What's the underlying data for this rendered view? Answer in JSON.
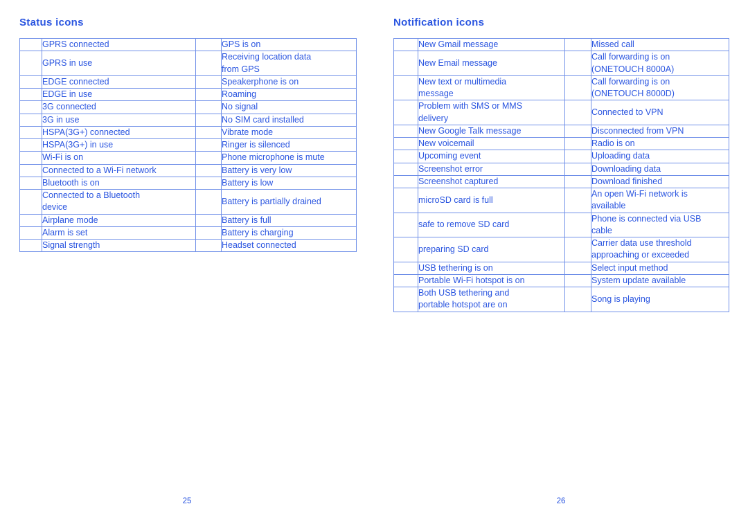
{
  "document": {
    "accent_color": "#2a55e0",
    "border_color": "#6f8fe8",
    "background_color": "#ffffff"
  },
  "left_page": {
    "heading": "Status icons",
    "page_number": "25",
    "rows": [
      {
        "icon_left": "status-icon",
        "label_left": "GPRS connected",
        "icon_right": "status-icon",
        "label_right": "GPS is on"
      },
      {
        "icon_left": "status-icon",
        "label_left": "GPRS in use",
        "icon_right": "status-icon",
        "label_right": "Receiving location data\nfrom GPS"
      },
      {
        "icon_left": "status-icon",
        "label_left": "EDGE connected",
        "icon_right": "status-icon",
        "label_right": "Speakerphone is on"
      },
      {
        "icon_left": "status-icon",
        "label_left": "EDGE in use",
        "icon_right": "status-icon",
        "label_right": "Roaming"
      },
      {
        "icon_left": "status-icon",
        "label_left": "3G connected",
        "icon_right": "status-icon",
        "label_right": "No signal"
      },
      {
        "icon_left": "status-icon",
        "label_left": "3G in use",
        "icon_right": "status-icon",
        "label_right": "No SIM card installed"
      },
      {
        "icon_left": "status-icon",
        "label_left": "HSPA(3G+) connected",
        "icon_right": "status-icon",
        "label_right": "Vibrate mode"
      },
      {
        "icon_left": "status-icon",
        "label_left": "HSPA(3G+) in use",
        "icon_right": "status-icon",
        "label_right": "Ringer is silenced"
      },
      {
        "icon_left": "status-icon",
        "label_left": "Wi-Fi is on",
        "icon_right": "status-icon",
        "label_right": "Phone microphone is mute"
      },
      {
        "icon_left": "status-icon",
        "label_left": "Connected to a Wi-Fi network",
        "icon_right": "status-icon",
        "label_right": "Battery is very low"
      },
      {
        "icon_left": "status-icon",
        "label_left": "Bluetooth is on",
        "icon_right": "status-icon",
        "label_right": "Battery is low"
      },
      {
        "icon_left": "status-icon",
        "label_left": "Connected to a Bluetooth\ndevice",
        "icon_right": "status-icon",
        "label_right": "Battery is partially drained"
      },
      {
        "icon_left": "status-icon",
        "label_left": "Airplane mode",
        "icon_right": "status-icon",
        "label_right": "Battery is full"
      },
      {
        "icon_left": "status-icon",
        "label_left": "Alarm is set",
        "icon_right": "status-icon",
        "label_right": "Battery is charging"
      },
      {
        "icon_left": "status-icon",
        "label_left": "Signal strength",
        "icon_right": "status-icon",
        "label_right": "Headset connected"
      }
    ]
  },
  "right_page": {
    "heading": "Notification icons",
    "page_number": "26",
    "rows": [
      {
        "icon_left": "notification-icon",
        "label_left": "New Gmail message",
        "icon_right": "notification-icon",
        "label_right": "Missed call"
      },
      {
        "icon_left": "notification-icon",
        "label_left": "New Email message",
        "icon_right": "notification-icon",
        "label_right": "Call forwarding is on\n(ONETOUCH 8000A)"
      },
      {
        "icon_left": "notification-icon",
        "label_left": "New text or multimedia\nmessage",
        "icon_right": "notification-icon",
        "label_right": "Call forwarding is on\n(ONETOUCH 8000D)"
      },
      {
        "icon_left": "notification-icon",
        "label_left": "Problem with SMS or MMS\ndelivery",
        "icon_right": "notification-icon",
        "label_right": "Connected to VPN"
      },
      {
        "icon_left": "notification-icon",
        "label_left": "New Google Talk message",
        "icon_right": "notification-icon",
        "label_right": "Disconnected from VPN"
      },
      {
        "icon_left": "notification-icon",
        "label_left": "New voicemail",
        "icon_right": "notification-icon",
        "label_right": "Radio is on"
      },
      {
        "icon_left": "notification-icon",
        "label_left": "Upcoming event",
        "icon_right": "notification-icon",
        "label_right": "Uploading data"
      },
      {
        "icon_left": "notification-icon",
        "label_left": "Screenshot error",
        "icon_right": "notification-icon",
        "label_right": "Downloading data"
      },
      {
        "icon_left": "notification-icon",
        "label_left": "Screenshot captured",
        "icon_right": "notification-icon",
        "label_right": "Download finished"
      },
      {
        "icon_left": "notification-icon",
        "label_left": "microSD card is full",
        "icon_right": "notification-icon",
        "label_right": "An open Wi-Fi network is\navailable"
      },
      {
        "icon_left": "notification-icon",
        "label_left": "safe to remove SD card",
        "icon_right": "notification-icon",
        "label_right": "Phone is connected via USB\ncable"
      },
      {
        "icon_left": "notification-icon",
        "label_left": "preparing SD card",
        "icon_right": "notification-icon",
        "label_right": "Carrier data use threshold\napproaching or exceeded"
      },
      {
        "icon_left": "notification-icon",
        "label_left": "USB tethering is on",
        "icon_right": "notification-icon",
        "label_right": "Select input method"
      },
      {
        "icon_left": "notification-icon",
        "label_left": "Portable Wi-Fi hotspot is on",
        "icon_right": "notification-icon",
        "label_right": "System update available"
      },
      {
        "icon_left": "notification-icon",
        "label_left": "Both USB tethering and\nportable hotspot are on",
        "icon_right": "notification-icon",
        "label_right": "Song is playing"
      }
    ]
  }
}
